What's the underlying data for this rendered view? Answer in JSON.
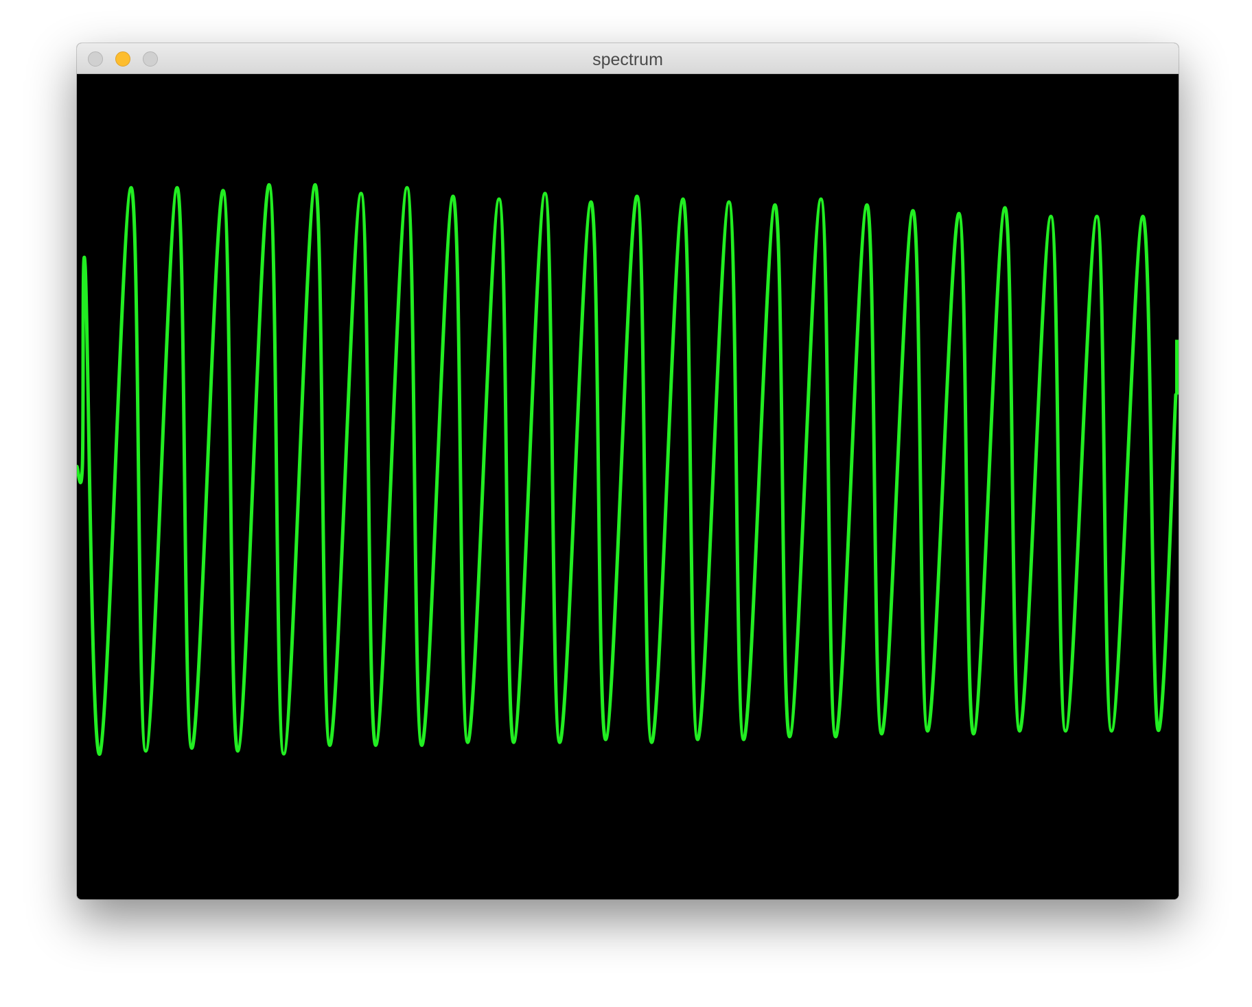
{
  "window": {
    "title": "spectrum",
    "buttons": {
      "close": "close-button",
      "minimize": "minimize-button",
      "zoom": "zoom-button"
    }
  },
  "colors": {
    "background": "#000000",
    "waveform": "#22ee22",
    "minimize_button": "#fdbd2e",
    "inactive_button": "#d0d0d0"
  },
  "chart_data": {
    "type": "line",
    "series": [
      {
        "peaks": [
          0.7,
          0.97,
          0.97,
          0.96,
          0.98,
          0.98,
          0.95,
          0.97,
          0.94,
          0.93,
          0.95,
          0.92,
          0.94,
          0.93,
          0.92,
          0.91,
          0.93,
          0.91,
          0.89,
          0.88,
          0.9,
          0.87,
          0.87,
          0.87
        ],
        "troughs": [
          -1.0,
          -0.99,
          -0.98,
          -0.99,
          -1.0,
          -0.97,
          -0.97,
          -0.97,
          -0.96,
          -0.96,
          -0.96,
          -0.95,
          -0.96,
          -0.95,
          -0.95,
          -0.94,
          -0.94,
          -0.93,
          -0.92,
          -0.93,
          -0.92,
          -0.92,
          -0.92,
          -0.91
        ]
      }
    ]
  }
}
